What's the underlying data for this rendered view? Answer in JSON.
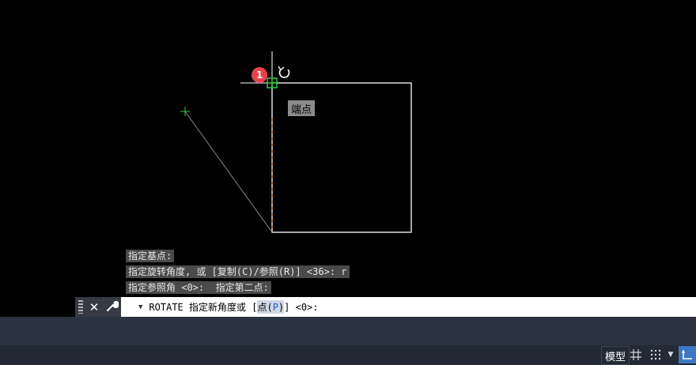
{
  "drawing": {
    "marker_badge": "1",
    "tooltip": "端点",
    "colors": {
      "background": "#000000",
      "geometry": "#ffffff",
      "ortho": "#ff8a00",
      "snap": "#2ecc40"
    }
  },
  "command_history": [
    "指定基点:",
    "指定旋转角度, 或 [复制(C)/参照(R)] <36>: r",
    "指定参照角 <0>:  指定第二点:"
  ],
  "command_line": {
    "close_icon": "close-icon",
    "customize_icon": "wrench-icon",
    "prefix": "ROTATE 指定新角度或 [",
    "option_label": "点(",
    "option_key": "P",
    "option_close": ")",
    "suffix": "] <0>:"
  },
  "status_bar": {
    "model_tab": "模型",
    "icons": [
      "grid-icon",
      "snap-dots-icon",
      "dropdown-icon",
      "ortho-icon"
    ]
  }
}
